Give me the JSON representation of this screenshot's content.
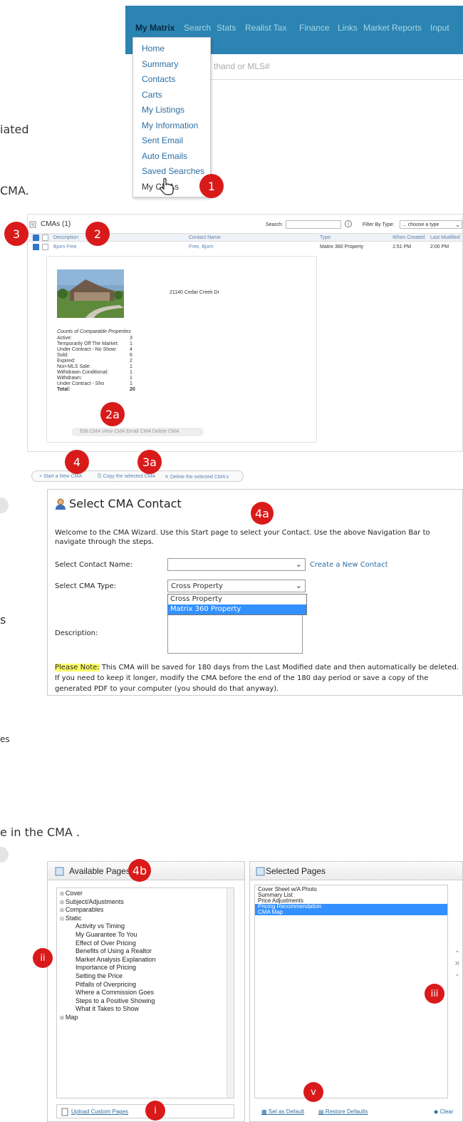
{
  "doc_fragments": {
    "f1": "iated",
    "f2": "CMA.",
    "f3": "s",
    "f4": "es",
    "f5": "e in the CMA ."
  },
  "topnav": {
    "items": [
      "My Matrix",
      "Search",
      "Stats",
      "Realist Tax",
      "Finance",
      "Links",
      "Market Reports",
      "Input"
    ],
    "search_placeholder": "thand or MLS#"
  },
  "dropdown": {
    "items": [
      "Home",
      "Summary",
      "Contacts",
      "Carts",
      "My Listings",
      "My Information",
      "Sent Email",
      "Auto Emails",
      "Saved Searches",
      "My CMAs"
    ]
  },
  "badges": {
    "b1": "1",
    "b2": "2",
    "b2a": "2a",
    "b3": "3",
    "b3a": "3a",
    "b4": "4",
    "b4a": "4a",
    "b4b": "4b",
    "bi": "i",
    "bii": "ii",
    "biii": "iii",
    "bv": "v"
  },
  "cma_table": {
    "title": "CMAs (1)",
    "search_label": "Search:",
    "filter_label": "Filter By Type:",
    "filter_value": "... choose a type",
    "headers": [
      "Description",
      "Contact Name",
      "Type",
      "When Created",
      "Last Modified"
    ],
    "row": {
      "description": "Bjorn Free",
      "contact": "Free, Bjorn",
      "type": "Matrix 360 Property",
      "created": "1:51 PM",
      "modified": "2:00 PM"
    },
    "address": "21140 Cedar Creek Dr",
    "counts_title": "Counts of Comparable Properties",
    "counts": [
      {
        "label": "Active:",
        "value": "3"
      },
      {
        "label": "Temporarily Off The Market:",
        "value": "1"
      },
      {
        "label": "Under Contract - No Show:",
        "value": "4"
      },
      {
        "label": "Sold:",
        "value": "6"
      },
      {
        "label": "Expired:",
        "value": "2"
      },
      {
        "label": "Non-MLS Sale:",
        "value": "1"
      },
      {
        "label": "Withdrawn Conditional:",
        "value": "1"
      },
      {
        "label": "Withdrawn:",
        "value": "1"
      },
      {
        "label": "Under Contract - Sho",
        "value": "1"
      },
      {
        "label": "Total:",
        "value": "20"
      }
    ],
    "actions": "Edit CMA   View CMA   Email CMA   Delete CMA"
  },
  "toolbar": {
    "start": "Start a New CMA",
    "copy": "Copy the selected CMA",
    "delete": "Delete the selected CMA's"
  },
  "wizard": {
    "title": "Select CMA Contact",
    "intro": "Welcome to the CMA Wizard. Use this Start page to select your Contact. Use the above Navigation Bar to navigate through the steps.",
    "contact_label": "Select Contact Name:",
    "create_link": "Create a New Contact",
    "type_label": "Select CMA Type:",
    "type_value": "Cross Property",
    "type_options": [
      "Cross Property",
      "Matrix 360 Property"
    ],
    "desc_label": "Description:",
    "note_label": "Please Note:",
    "note_text": " This CMA will be saved for 180 days from the Last Modified date and then automatically be deleted. If you need to keep it longer, modify the CMA before the end of the 180 day period or save a copy of the generated PDF to your computer (you should do that anyway)."
  },
  "available": {
    "title": "Available Pages",
    "tree": [
      "Cover",
      "Subject/Adjustments",
      "Comparables",
      "Static"
    ],
    "static_items": [
      "Activity vs Timing",
      "My Guarantee To You",
      "Effect of Over Pricing",
      "Benefits of Using a Realtor",
      "Market Analysis Explanation",
      "Importance of Pricing",
      "Setting the Price",
      "Pitfalls of Overpricing",
      "Where a Commission Goes",
      "Steps to a Positive Showing",
      "What it Takes to Show"
    ],
    "map": "Map",
    "upload": "Upload Custom Pages"
  },
  "selected": {
    "title": "Selected Pages",
    "items": [
      "Cover Sheet w/A Photo",
      "Summary List",
      "Price Adjustments",
      "Pricing Recommendation",
      "CMA Map"
    ],
    "set_default": "Set as Default",
    "restore": "Restore Defaults",
    "clear": "Clear"
  },
  "colors": {
    "nav_bg": "#2b84b1",
    "badge": "#d91a1a",
    "highlight": "#3390ff",
    "note_highlight": "#ffff66"
  }
}
